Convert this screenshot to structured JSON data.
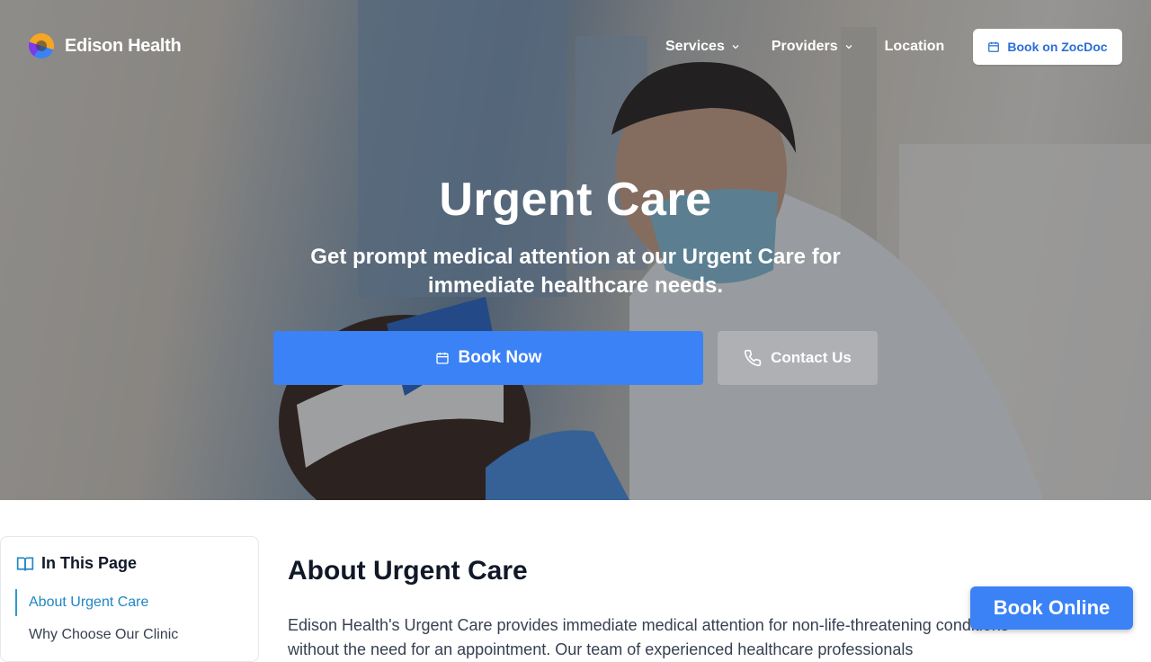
{
  "brand": {
    "name": "Edison Health"
  },
  "nav": {
    "services": "Services",
    "providers": "Providers",
    "location": "Location",
    "zocdoc_button": "Book on ZocDoc"
  },
  "hero": {
    "title": "Urgent Care",
    "subtitle": "Get prompt medical attention at our Urgent Care for immediate healthcare needs.",
    "book_now": "Book Now",
    "contact_us": "Contact Us",
    "image": "doctor-swab-test-photo"
  },
  "toc": {
    "heading": "In This Page",
    "items": [
      "About Urgent Care",
      "Why Choose Our Clinic"
    ]
  },
  "main": {
    "about_title": "About Urgent Care",
    "about_text": "Edison Health's Urgent Care provides immediate medical attention for non-life-threatening conditions without the need for an appointment. Our team of experienced healthcare professionals"
  },
  "floating": {
    "book_online": "Book Online"
  },
  "colors": {
    "primary": "#3b82f6",
    "zocdoc_text": "#2b6fd6",
    "toc_active": "#1f86c2"
  }
}
